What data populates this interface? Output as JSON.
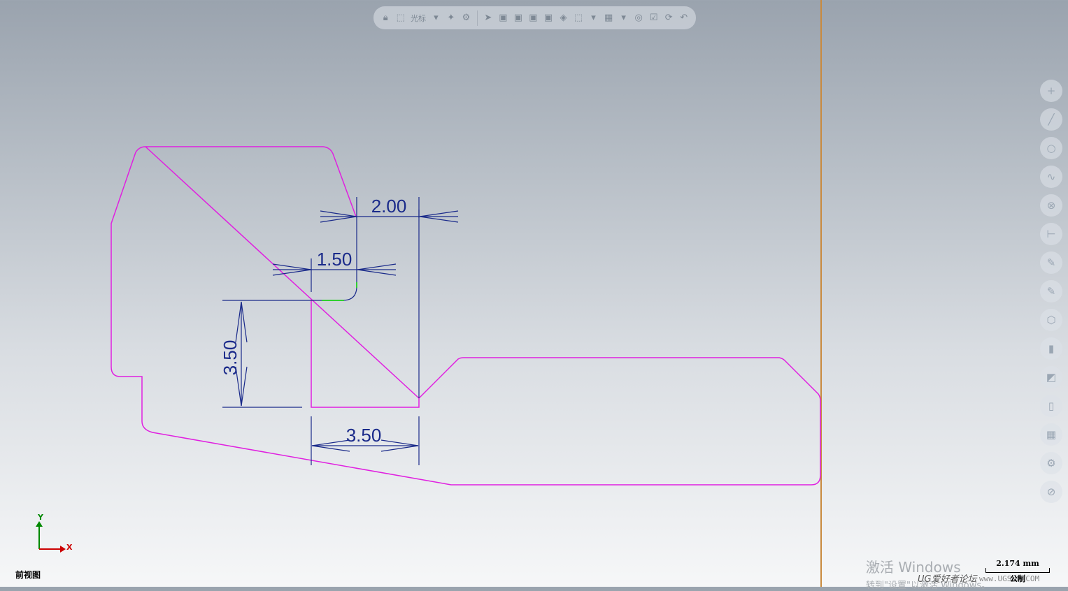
{
  "toolbar": {
    "cursor_label": "光标"
  },
  "view": {
    "name": "前视图",
    "axis_x": "X",
    "axis_y": "Y"
  },
  "dimensions": {
    "d1": "2.00",
    "d2": "1.50",
    "d3": "3.50",
    "d4": "3.50"
  },
  "scale": {
    "value": "2.174 mm",
    "unit": "公制"
  },
  "activation": {
    "title": "激活 Windows",
    "subtitle": "转到\"设置\"以激活 Windows。"
  },
  "watermark": {
    "text": "UG爱好者论坛",
    "site": "www.UGSNX.COM"
  },
  "colors": {
    "profile": "#e020e0",
    "dimension": "#1a2a8a",
    "highlight": "#30d030",
    "axis_x": "#cc0000",
    "axis_y": "#008800"
  },
  "icons": {
    "toolbar": [
      "lock-icon",
      "select-icon",
      "dropdown-icon",
      "snap-icon",
      "gear-icon",
      "arrow-icon",
      "cube-icon",
      "cube-icon",
      "cube-icon",
      "cube-icon",
      "cube-icon",
      "select-box-icon",
      "dropdown-icon",
      "rect-select-icon",
      "dropdown-icon",
      "layer-icon",
      "filter-icon",
      "rotate-icon",
      "undo-icon"
    ],
    "right_bar": [
      "plus-icon",
      "line-icon",
      "circle-icon",
      "curve-icon",
      "sphere-icon",
      "dimension-icon",
      "brush-icon",
      "brush-icon",
      "cube-icon",
      "box-icon",
      "color-icon",
      "panel-icon",
      "grid-icon",
      "gear-icon",
      "cancel-icon"
    ]
  }
}
